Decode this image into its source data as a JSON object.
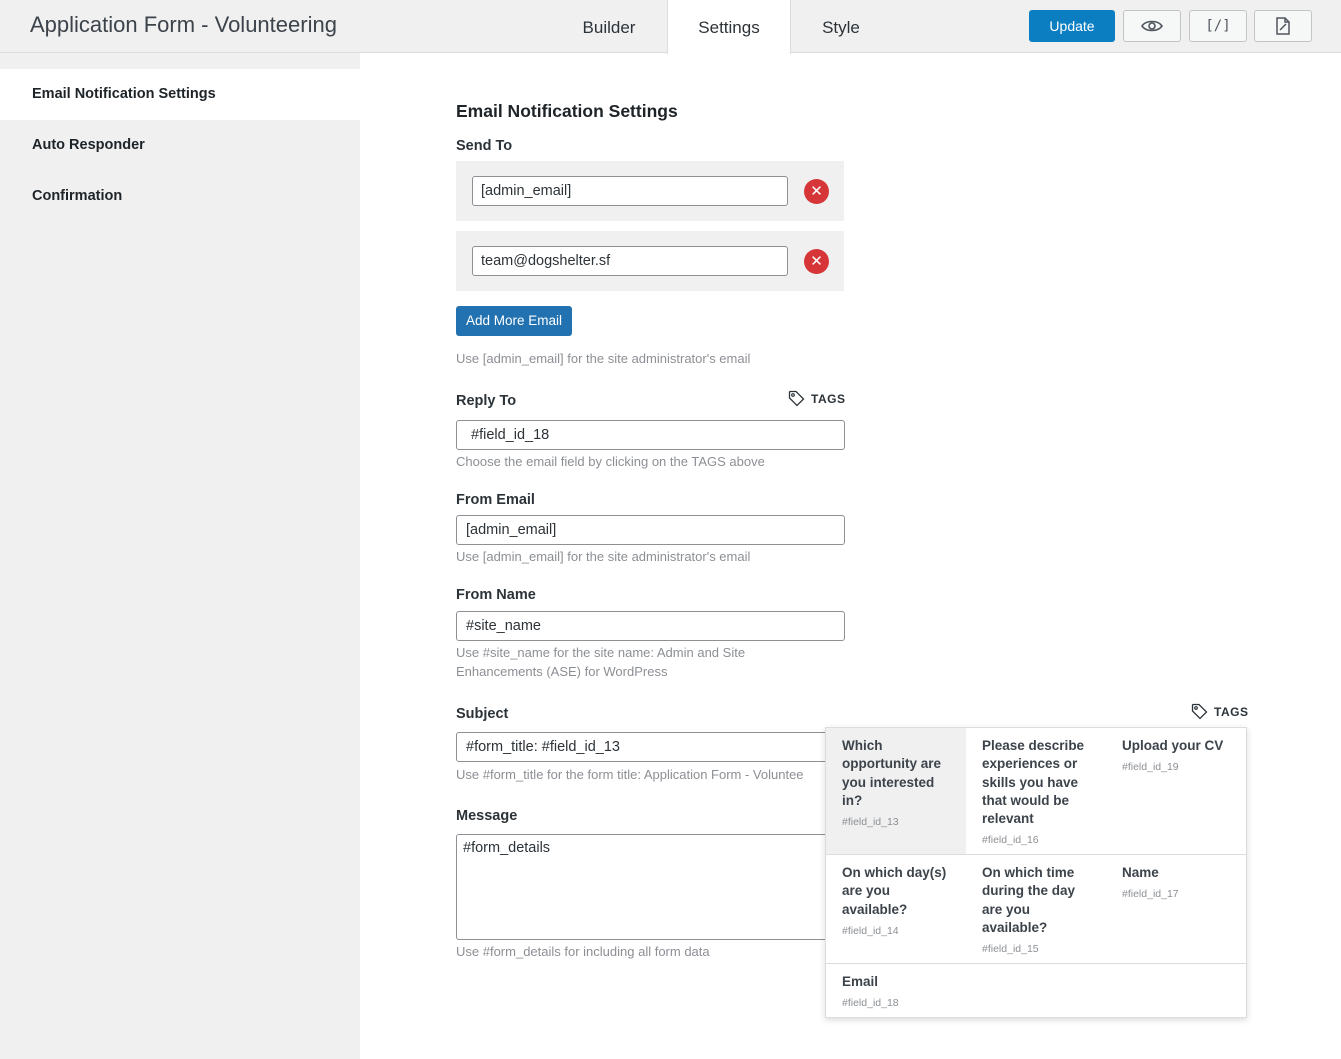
{
  "header": {
    "title": "Application Form - Volunteering",
    "tabs": [
      "Builder",
      "Settings",
      "Style"
    ],
    "update_label": "Update",
    "code_icon_text": "[/]"
  },
  "sidebar": {
    "items": [
      {
        "label": "Email Notification Settings",
        "active": true
      },
      {
        "label": "Auto Responder",
        "active": false
      },
      {
        "label": "Confirmation",
        "active": false
      }
    ]
  },
  "main": {
    "section_title": "Email Notification Settings",
    "send_to": {
      "label": "Send To",
      "emails": [
        "[admin_email]",
        "team@dogshelter.sf"
      ],
      "add_label": "Add More Email",
      "hint": "Use [admin_email] for the site administrator's email"
    },
    "reply_to": {
      "label": "Reply To",
      "tags_label": "TAGS",
      "value": "#field_id_18",
      "hint": "Choose the email field by clicking on the TAGS above"
    },
    "from_email": {
      "label": "From Email",
      "value": "[admin_email]",
      "hint": "Use [admin_email] for the site administrator's email"
    },
    "from_name": {
      "label": "From Name",
      "value": "#site_name",
      "hint_line1": "Use #site_name for the site name: Admin and Site",
      "hint_line2": "Enhancements (ASE) for WordPress"
    },
    "subject": {
      "label": "Subject",
      "tags_label": "TAGS",
      "value": "#form_title:  #field_id_13",
      "hint": "Use #form_title for the form title: Application Form - Voluntee"
    },
    "message": {
      "label": "Message",
      "value": "#form_details",
      "hint": "Use #form_details for including all form data"
    }
  },
  "tags_dropdown": {
    "items": [
      {
        "question": "Which opportunity are you interested in?",
        "id": "#field_id_13"
      },
      {
        "question": "Please describe experiences or skills you have that would be relevant",
        "id": "#field_id_16"
      },
      {
        "question": "Upload your CV",
        "id": "#field_id_19"
      },
      {
        "question": "On which day(s) are you available?",
        "id": "#field_id_14"
      },
      {
        "question": "On which time during the day are you available?",
        "id": "#field_id_15"
      },
      {
        "question": "Name",
        "id": "#field_id_17"
      },
      {
        "question": "Email",
        "id": "#field_id_18"
      }
    ]
  },
  "colors": {
    "primary_button": "#2271b1",
    "update_button": "#0b7ec1",
    "remove_icon": "#d63638",
    "sidebar_bg": "#f0f0f1"
  }
}
